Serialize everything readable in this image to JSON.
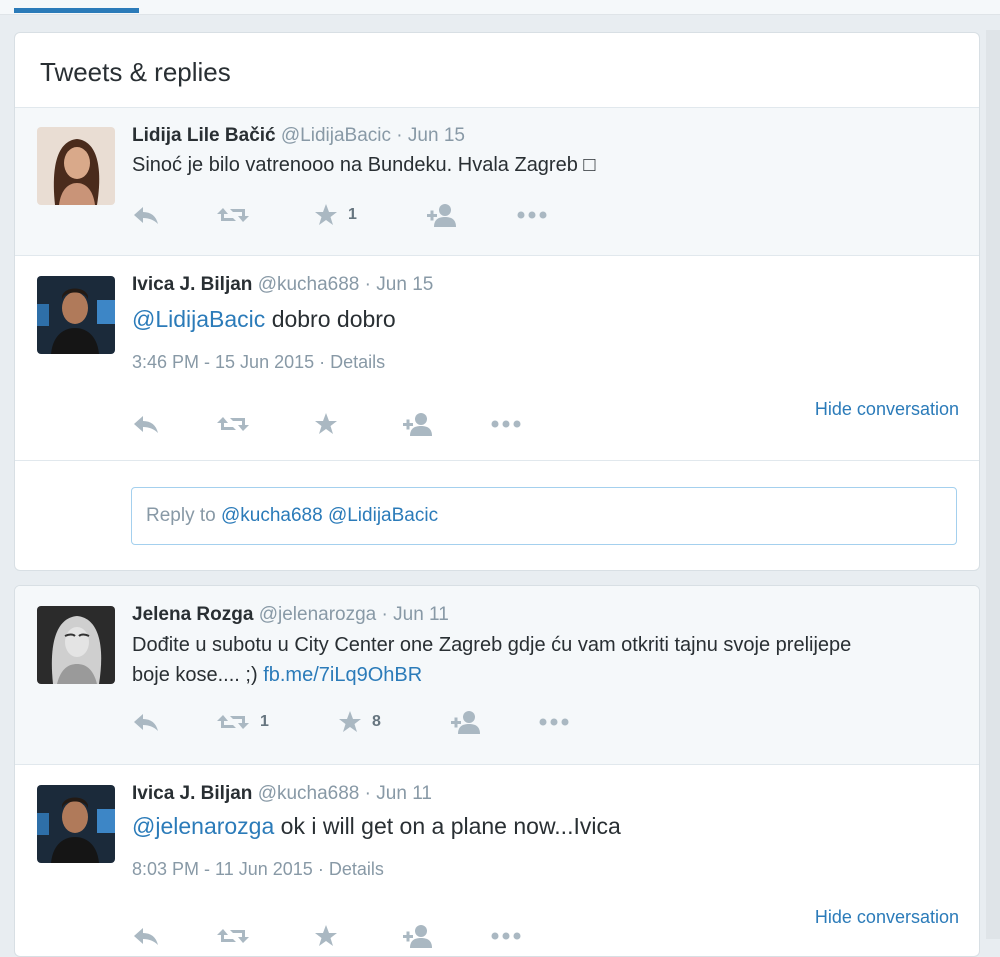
{
  "section_title": "Tweets & replies",
  "reply_box": {
    "prefix": "Reply to",
    "mentions": "@kucha688 @LidijaBacic"
  },
  "tweets": [
    {
      "name": "Lidija Lile Bačić",
      "handle": "@LidijaBacic",
      "date": "Jun 15",
      "text": "Sinoć je bilo vatrenooo na Bundeku. Hvala Zagreb □",
      "favorites": "1"
    },
    {
      "name": "Ivica J. Biljan",
      "handle": "@kucha688",
      "date": "Jun 15",
      "mention": "@LidijaBacic",
      "text": "dobro dobro",
      "timestamp": "3:46 PM - 15 Jun 2015",
      "details": "Details",
      "hide": "Hide conversation"
    },
    {
      "name": "Jelena Rozga",
      "handle": "@jelenarozga",
      "date": "Jun 11",
      "text": "Dođite u subotu u City Center one Zagreb gdje ću vam otkriti tajnu svoje prelijepe boje kose.... ;)",
      "link": "fb.me/7iLq9OhBR",
      "retweets": "1",
      "favorites": "8"
    },
    {
      "name": "Ivica J. Biljan",
      "handle": "@kucha688",
      "date": "Jun 11",
      "mention": "@jelenarozga",
      "text": "ok i will get on a plane now...Ivica",
      "timestamp": "8:03 PM - 11 Jun 2015",
      "details": "Details",
      "hide": "Hide conversation"
    }
  ],
  "colors": {
    "link": "#2b7bb9",
    "muted": "#8899a6",
    "icon": "#aab8c2"
  }
}
